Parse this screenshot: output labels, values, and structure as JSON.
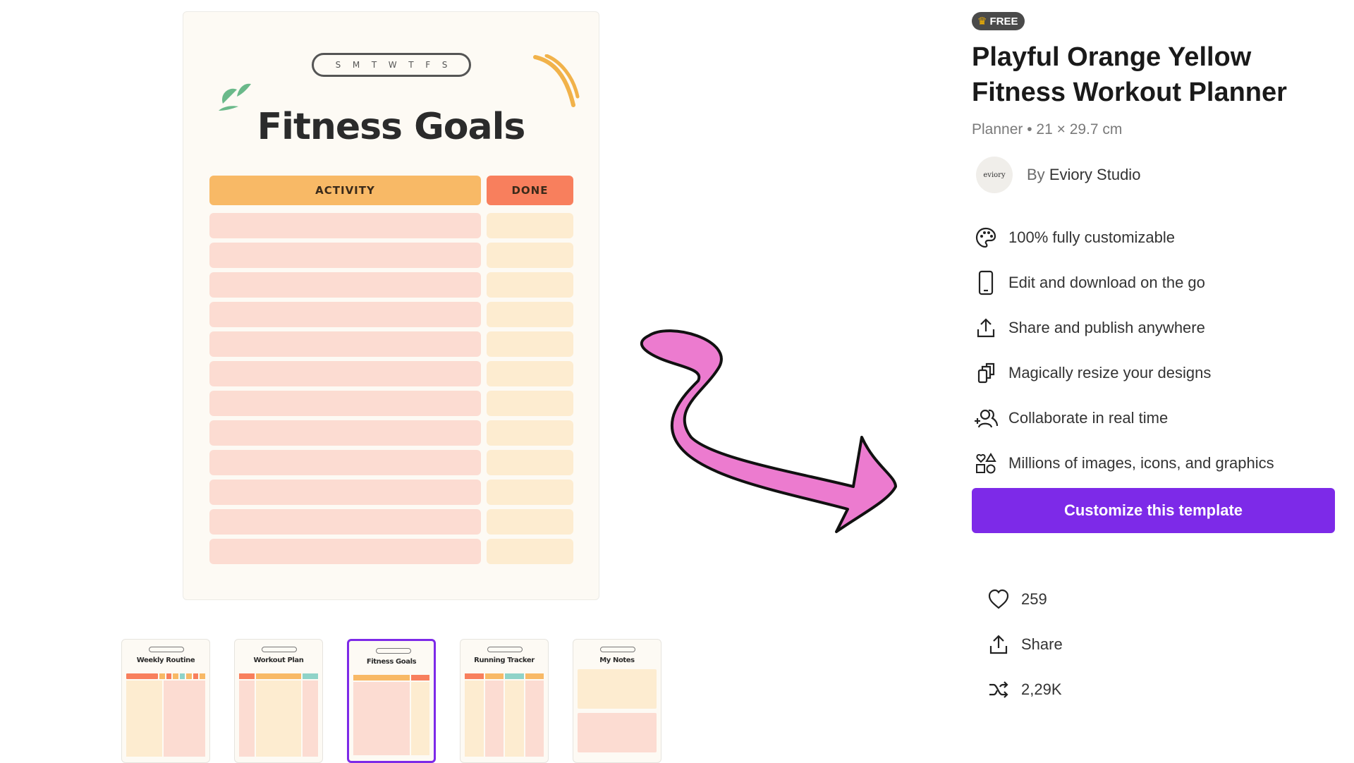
{
  "preview": {
    "days": [
      "S",
      "M",
      "T",
      "W",
      "T",
      "F",
      "S"
    ],
    "title": "Fitness Goals",
    "header_activity": "ACTIVITY",
    "header_done": "DONE",
    "row_count": 12,
    "colors": {
      "activity_header": "#f8b966",
      "done_header": "#f87f5d",
      "activity_cell": "#fcdcd2",
      "done_cell": "#fdecd0"
    }
  },
  "thumbnails": [
    {
      "title": "Weekly Routine",
      "selected": false
    },
    {
      "title": "Workout Plan",
      "selected": false
    },
    {
      "title": "Fitness Goals",
      "selected": true
    },
    {
      "title": "Running Tracker",
      "selected": false
    },
    {
      "title": "My Notes",
      "selected": false
    }
  ],
  "panel": {
    "badge": "FREE",
    "title": "Playful Orange Yellow Fitness Workout Planner",
    "subtitle": "Planner • 21 × 29.7 cm",
    "author_by": "By",
    "author_name": "Eviory Studio",
    "avatar_text": "eviory",
    "features": [
      {
        "icon": "palette-icon",
        "label": "100% fully customizable"
      },
      {
        "icon": "phone-icon",
        "label": "Edit and download on the go"
      },
      {
        "icon": "share-icon",
        "label": "Share and publish anywhere"
      },
      {
        "icon": "resize-icon",
        "label": "Magically resize your designs"
      },
      {
        "icon": "collaborate-icon",
        "label": "Collaborate in real time"
      },
      {
        "icon": "elements-icon",
        "label": "Millions of images, icons, and graphics"
      }
    ],
    "cta": "Customize this template",
    "likes": "259",
    "share": "Share",
    "remixes": "2,29K",
    "accent_color": "#7d2ae8"
  }
}
